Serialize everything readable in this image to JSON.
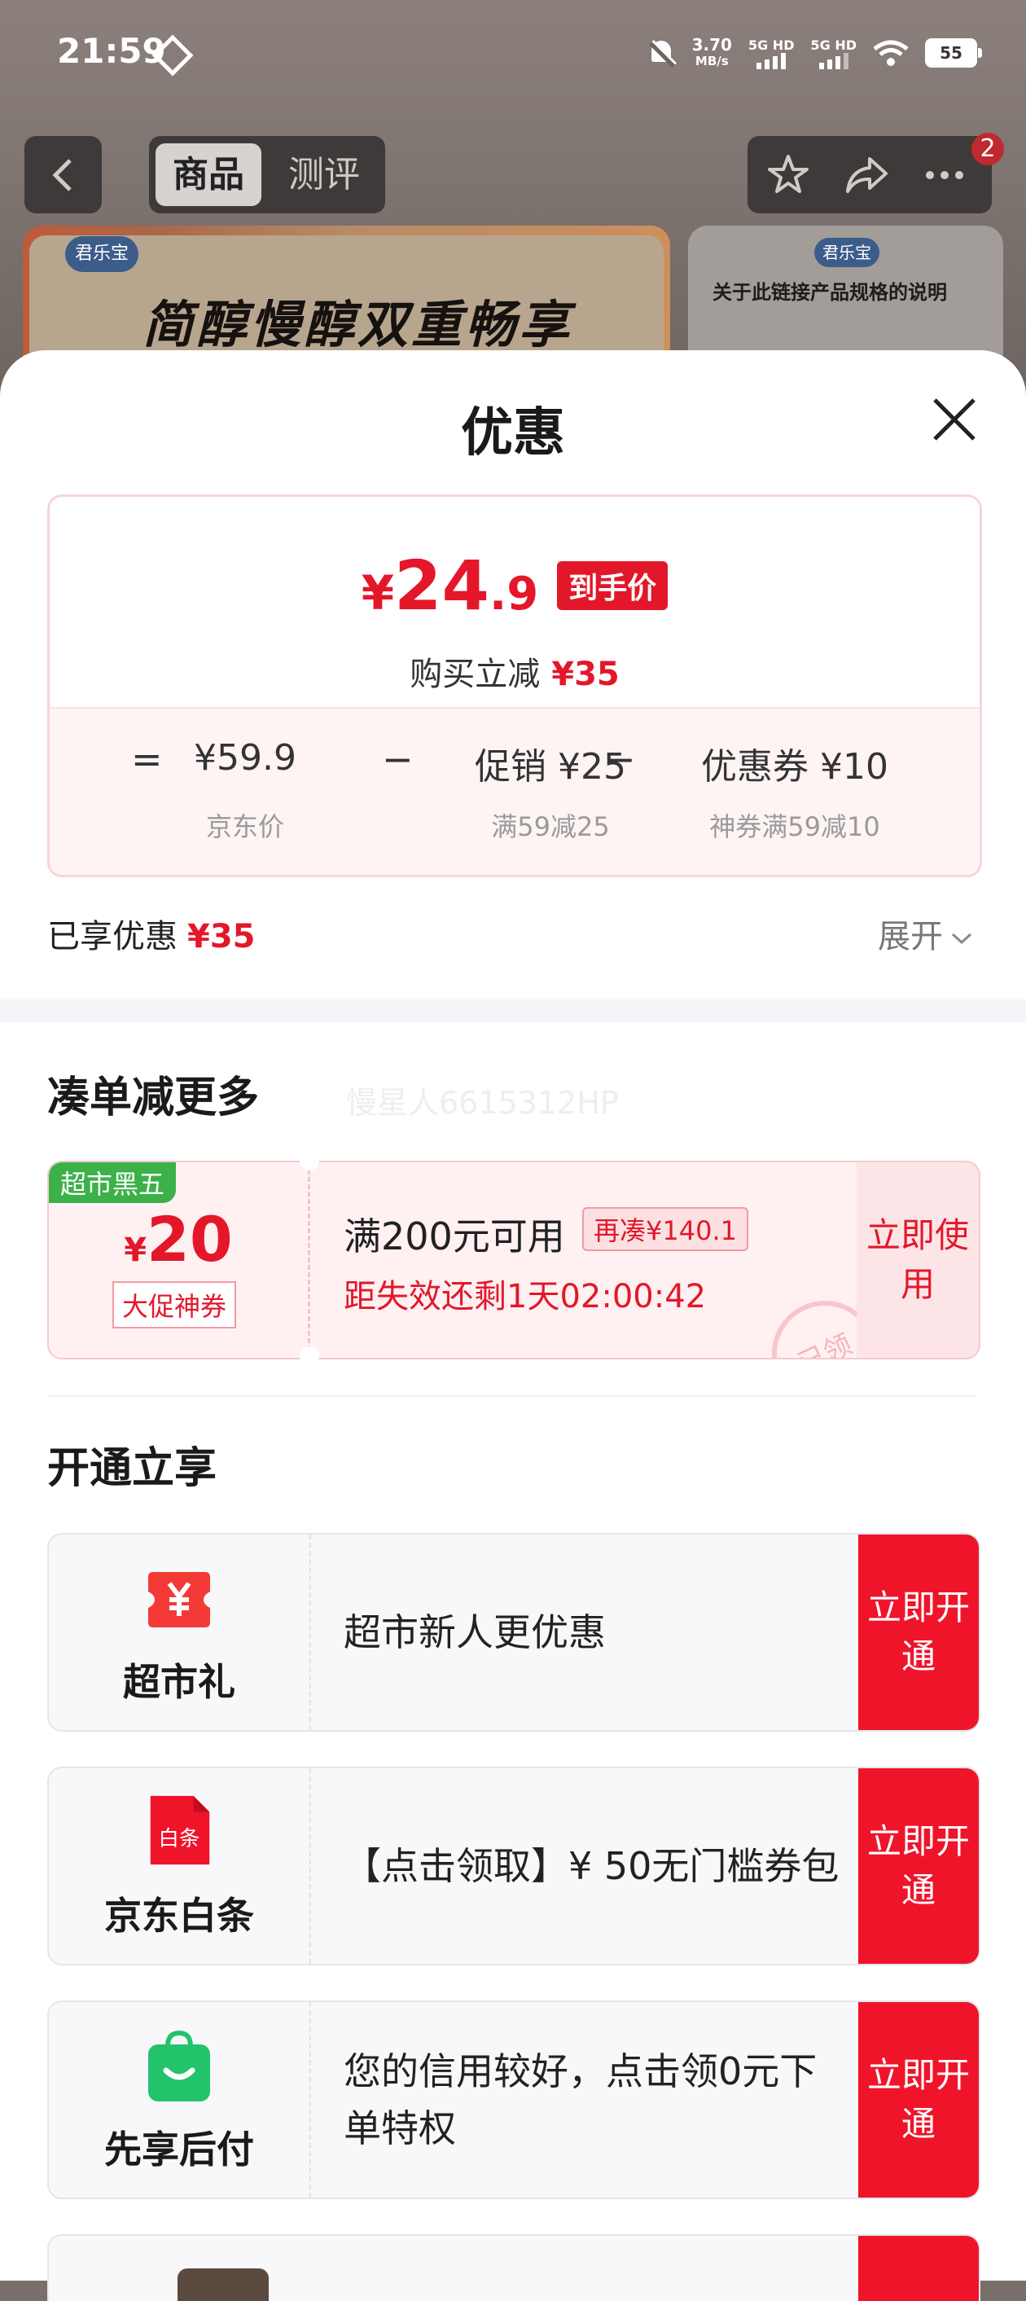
{
  "status_bar": {
    "time": "21:59",
    "net_speed": "3.70",
    "net_unit": "MB/s",
    "sim1": "5G HD",
    "sim2": "5G HD",
    "battery": "55"
  },
  "top_nav": {
    "tabs": [
      "商品",
      "测评"
    ],
    "active_tab": "商品",
    "more_badge": "2"
  },
  "banner": {
    "logo": "君乐宝",
    "title": "简醇慢醇双重畅享",
    "right_logo": "君乐宝",
    "right_text": "关于此链接产品规格的说明"
  },
  "sheet": {
    "title": "优惠"
  },
  "price_card": {
    "final_price_yen": "¥",
    "final_price_int": "24",
    "final_price_dec": ".9",
    "final_tag": "到手价",
    "reduce_label": "购买立减",
    "reduce_amount": "¥35",
    "breakdown": {
      "eq": "=",
      "minus": "−",
      "items": [
        {
          "value": "¥59.9",
          "sub": "京东价"
        },
        {
          "value": "促销 ¥25",
          "sub": "满59减25"
        },
        {
          "value": "优惠券 ¥10",
          "sub": "神券满59减10"
        }
      ]
    }
  },
  "enjoyed": {
    "label": "已享优惠",
    "amount": "¥35",
    "expand": "展开"
  },
  "bundle": {
    "title": "凑单减更多",
    "watermark": "慢星人6615312HP",
    "coupon": {
      "tag": "超市黑五",
      "yen": "¥",
      "amount": "20",
      "type": "大促神券",
      "condition": "满200元可用",
      "more": "再凑¥140.1",
      "countdown": "距失效还剩1天02:00:42",
      "action": "立即使用",
      "stamp": "已领"
    }
  },
  "open_section": {
    "title": "开通立享",
    "items": [
      {
        "name": "超市礼",
        "desc": "超市新人更优惠",
        "action": "立即开通",
        "icon": "supermarket-gift-icon",
        "color": "#f43a36"
      },
      {
        "name": "京东白条",
        "desc": "【点击领取】¥ 50无门槛券包",
        "action": "立即开通",
        "icon": "baitiao-icon",
        "icon_text": "白条",
        "color": "#f0142b"
      },
      {
        "name": "先享后付",
        "desc": "您的信用较好，点击领0元下单特权",
        "action": "立即开通",
        "icon": "pay-later-bag-icon",
        "color": "#22c36b"
      }
    ]
  },
  "colors": {
    "accent_red": "#e4172a",
    "button_red": "#f0142b",
    "tag_green": "#3cb14a"
  }
}
